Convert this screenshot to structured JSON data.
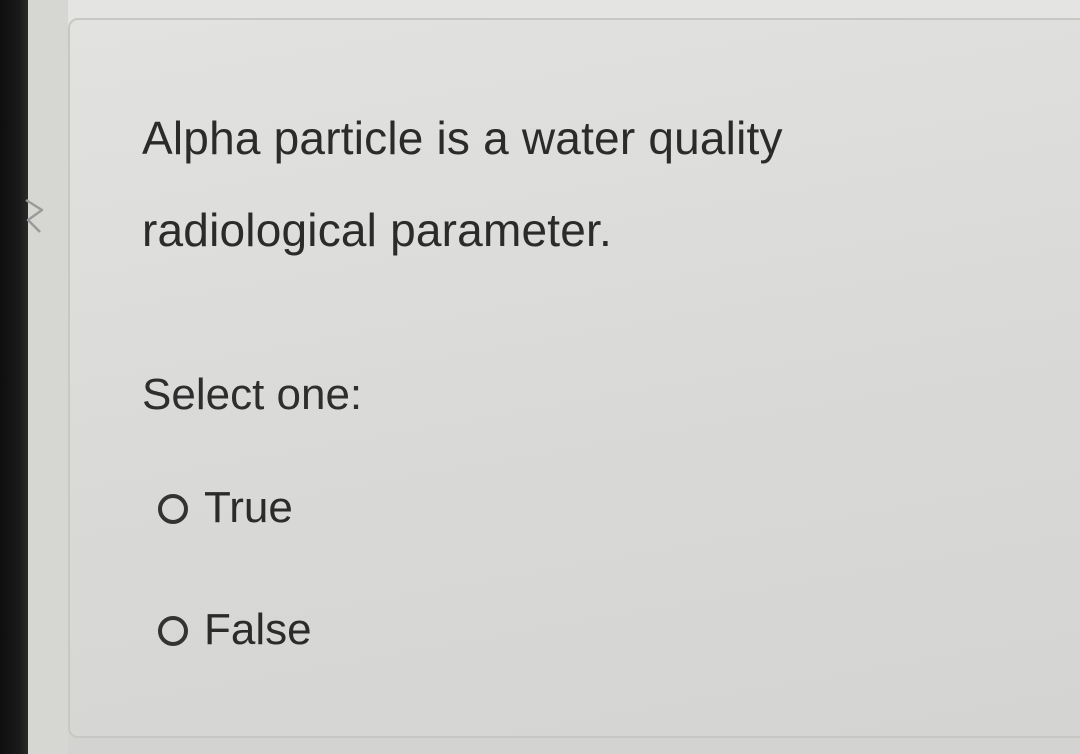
{
  "question": {
    "text": "Alpha particle is a water quality radiological parameter."
  },
  "answer": {
    "prompt": "Select one:",
    "options": [
      {
        "label": "True",
        "selected": false
      },
      {
        "label": "False",
        "selected": false
      }
    ]
  },
  "icons": {
    "flag": "flag-icon"
  },
  "colors": {
    "text": "#2b2b2b",
    "card_border": "#c7c7c4",
    "background": "#d9d9d6"
  }
}
